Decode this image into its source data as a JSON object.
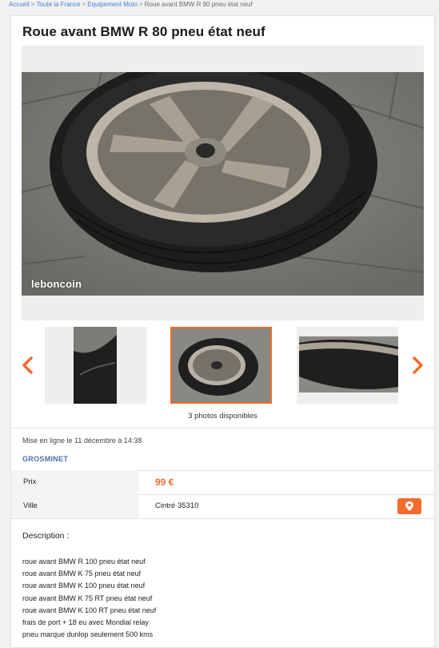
{
  "breadcrumb": {
    "items": [
      "Accueil",
      "Toute la France",
      "Equipement Moto"
    ],
    "current": "Roue avant BMW R 80 pneu état neuf",
    "separator": ">"
  },
  "ad": {
    "title": "Roue avant BMW R 80 pneu état neuf",
    "watermark": "leboncoin",
    "photos_count": "3 photos disponibles",
    "posted": "Mise en ligne le 11 décembre à 14:38",
    "seller": "GROSMINET",
    "price_label": "Prix",
    "price": "99 €",
    "city_label": "Ville",
    "city": "Cintré 35310",
    "description_heading": "Description :",
    "description_lines": [
      "roue avant BMW R 100 pneu état neuf",
      "roue avant BMW K 75 pneu état neuf",
      "roue avant BMW K 100 pneu état neuf",
      "roue avant BMW K 75 RT pneu état neuf",
      "roue avant BMW K 100 RT pneu état neuf",
      "frais de port + 18 eu avec Mondial relay",
      "pneu marque dunlop seulement 500 kms"
    ]
  },
  "colors": {
    "accent": "#f56b2a",
    "seller": "#4a6fa5",
    "link": "#4183d7"
  },
  "icons": {
    "prev": "chevron-left-icon",
    "next": "chevron-right-icon",
    "map": "map-pin-icon"
  }
}
